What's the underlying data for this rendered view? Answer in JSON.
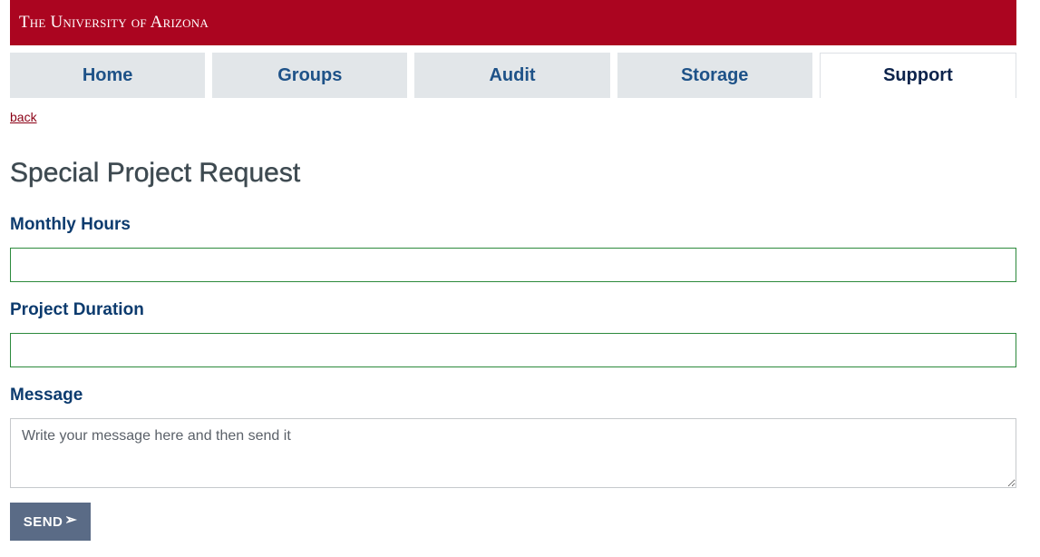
{
  "header": {
    "brand": "The University of Arizona"
  },
  "nav": {
    "tabs": [
      {
        "label": "Home"
      },
      {
        "label": "Groups"
      },
      {
        "label": "Audit"
      },
      {
        "label": "Storage"
      },
      {
        "label": "Support"
      }
    ]
  },
  "back_link": "back",
  "form": {
    "title": "Special Project Request",
    "monthly_hours_label": "Monthly Hours",
    "monthly_hours_value": "",
    "duration_label": "Project Duration",
    "duration_value": "",
    "message_label": "Message",
    "message_placeholder": "Write your message here and then send it",
    "send_label": "SEND",
    "send_icon": "send-arrow-icon"
  },
  "colors": {
    "brand_red": "#ab0520",
    "label_blue": "#0c3b6e",
    "tab_bg": "#e2e6e9",
    "button_bg": "#5a6b86"
  }
}
